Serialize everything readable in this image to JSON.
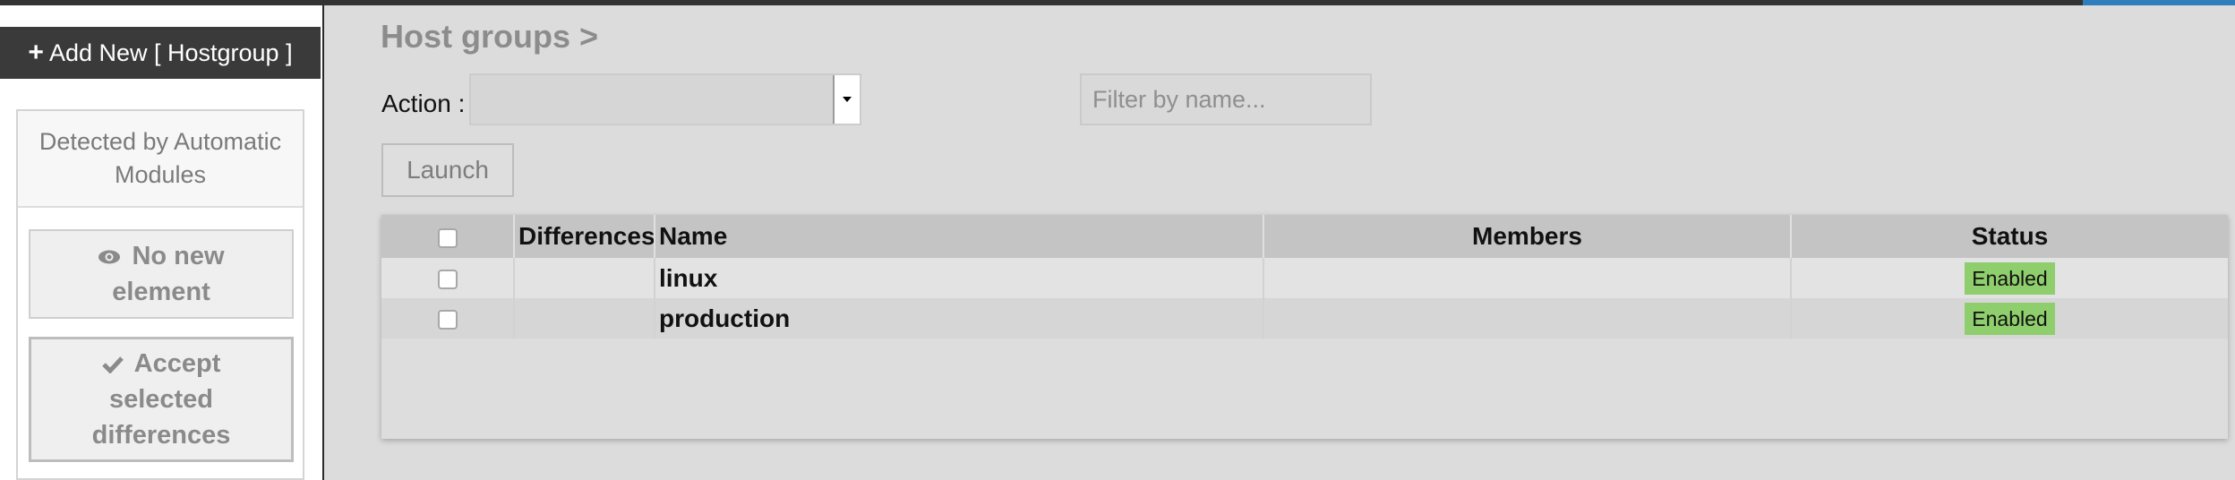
{
  "sidebar": {
    "add_new_label": "Add New [ Hostgroup ]",
    "module_panel": {
      "title": "Detected by Automatic Modules",
      "no_new_label": "No new element",
      "accept_label": "Accept selected differences"
    }
  },
  "main": {
    "title": "Host groups >",
    "action_label": "Action :",
    "action_selected": "",
    "filter_placeholder": "Filter by name...",
    "launch_label": "Launch",
    "table": {
      "columns": [
        "",
        "Differences",
        "Name",
        "Members",
        "Status"
      ],
      "rows": [
        {
          "differences": "",
          "name": "linux",
          "members": "",
          "status": "Enabled"
        },
        {
          "differences": "",
          "name": "production",
          "members": "",
          "status": "Enabled"
        }
      ]
    }
  },
  "colors": {
    "status_enabled": "#8fce6c",
    "top_bar": "#333333",
    "accent": "#2f7dbd"
  },
  "icons": {
    "add": "plus-icon",
    "no_new": "eye-icon",
    "accept": "check-icon",
    "select": "dropdown-arrow-icon"
  }
}
